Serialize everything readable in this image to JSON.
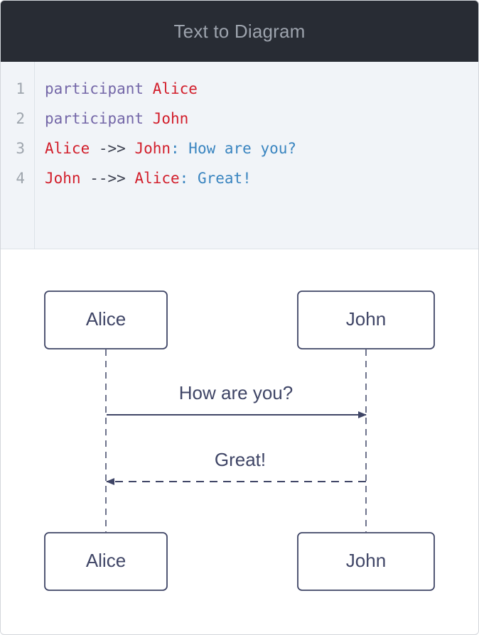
{
  "app": {
    "title": "Text to Diagram"
  },
  "editor": {
    "lines": [
      {
        "number": "1",
        "tokens": [
          {
            "type": "kw",
            "text": "participant"
          },
          {
            "type": "ws",
            "text": " "
          },
          {
            "type": "name",
            "text": "Alice"
          }
        ]
      },
      {
        "number": "2",
        "tokens": [
          {
            "type": "kw",
            "text": "participant"
          },
          {
            "type": "ws",
            "text": " "
          },
          {
            "type": "name",
            "text": "John"
          }
        ]
      },
      {
        "number": "3",
        "tokens": [
          {
            "type": "name",
            "text": "Alice"
          },
          {
            "type": "arr",
            "text": " ->> "
          },
          {
            "type": "name",
            "text": "John"
          },
          {
            "type": "msg",
            "text": ": How are you?"
          }
        ]
      },
      {
        "number": "4",
        "tokens": [
          {
            "type": "name",
            "text": "John"
          },
          {
            "type": "arr",
            "text": " -->> "
          },
          {
            "type": "name",
            "text": "Alice"
          },
          {
            "type": "msg",
            "text": ": Great!"
          }
        ]
      }
    ]
  },
  "diagram": {
    "participants": [
      "Alice",
      "John"
    ],
    "messages": [
      {
        "from": "Alice",
        "to": "John",
        "text": "How are you?",
        "style": "solid"
      },
      {
        "from": "John",
        "to": "Alice",
        "text": "Great!",
        "style": "dashed"
      }
    ]
  },
  "colors": {
    "titlebar_bg": "#282c34",
    "title_text": "#9da3ad",
    "keyword": "#7467a8",
    "participant": "#d21e2b",
    "message": "#3a85c0",
    "diagram_stroke": "#3f4566"
  }
}
